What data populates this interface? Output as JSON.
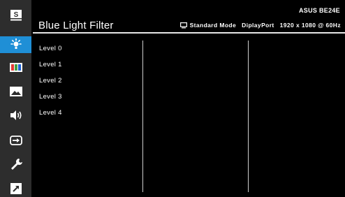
{
  "header": {
    "title": "Blue Light Filter",
    "model": "ASUS BE24E",
    "mode": "Standard Mode",
    "input": "DiplayPort",
    "resolution": "1920 x 1080 @ 60Hz"
  },
  "sidebar": {
    "items": [
      {
        "icon": "splendid-icon",
        "active": false
      },
      {
        "icon": "blue-light-filter-icon",
        "active": true
      },
      {
        "icon": "color-icon",
        "active": false
      },
      {
        "icon": "image-icon",
        "active": false
      },
      {
        "icon": "sound-icon",
        "active": false
      },
      {
        "icon": "input-select-icon",
        "active": false
      },
      {
        "icon": "system-setup-icon",
        "active": false
      },
      {
        "icon": "shortcut-icon",
        "active": false
      }
    ]
  },
  "menu": {
    "levels": [
      "Level 0",
      "Level 1",
      "Level 2",
      "Level 3",
      "Level 4"
    ]
  },
  "colors": {
    "accent": "#1f8fd6",
    "sidebar_bg": "#2d2d2d",
    "background": "#000000"
  }
}
